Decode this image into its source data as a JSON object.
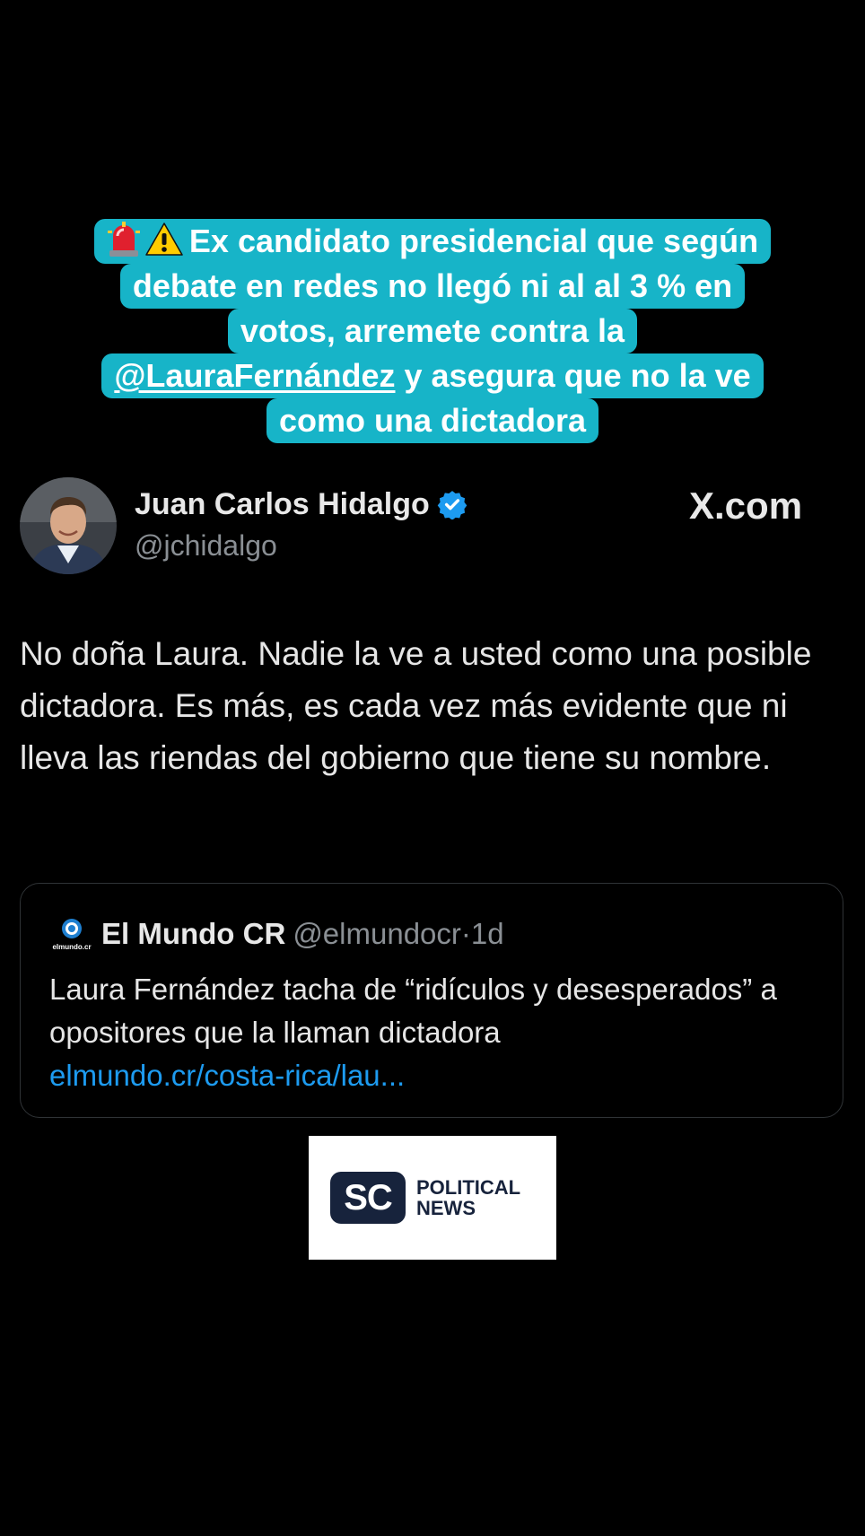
{
  "headline": {
    "line1": "Ex candidato presidencial que según",
    "line2": "debate en redes no llegó ni al al 3 % en",
    "line3": "votos, arremete contra la",
    "line4_mention": "@LauraFernández",
    "line4_rest": " y asegura que no la ve",
    "line5": "como una dictadora",
    "emoji_icons": [
      "siren-icon",
      "warning-icon"
    ]
  },
  "tweet": {
    "author_name": "Juan Carlos Hidalgo",
    "author_handle": "@jchidalgo",
    "verified": true,
    "platform": "X.com",
    "text": "No doña Laura. Nadie la ve a usted como una posible dictadora. Es más, es cada vez más evidente que ni lleva las riendas del gobierno que tiene su nombre."
  },
  "quoted_tweet": {
    "name": "El Mundo CR",
    "handle": "@elmundocr",
    "separator": "·",
    "time": "1d",
    "logo_text": "elmundo.cr",
    "text": "Laura Fernández tacha de “ridículos y desesperados” a opositores que la llaman dictadora",
    "link": "elmundo.cr/costa-rica/lau..."
  },
  "watermark": {
    "mark": "SC",
    "line1": "POLITICAL",
    "line2": "NEWS"
  },
  "colors": {
    "background": "#000000",
    "banner": "#17b4c8",
    "link": "#1d9bf0",
    "verified": "#1d9bf0",
    "logo_navy": "#17233c"
  }
}
